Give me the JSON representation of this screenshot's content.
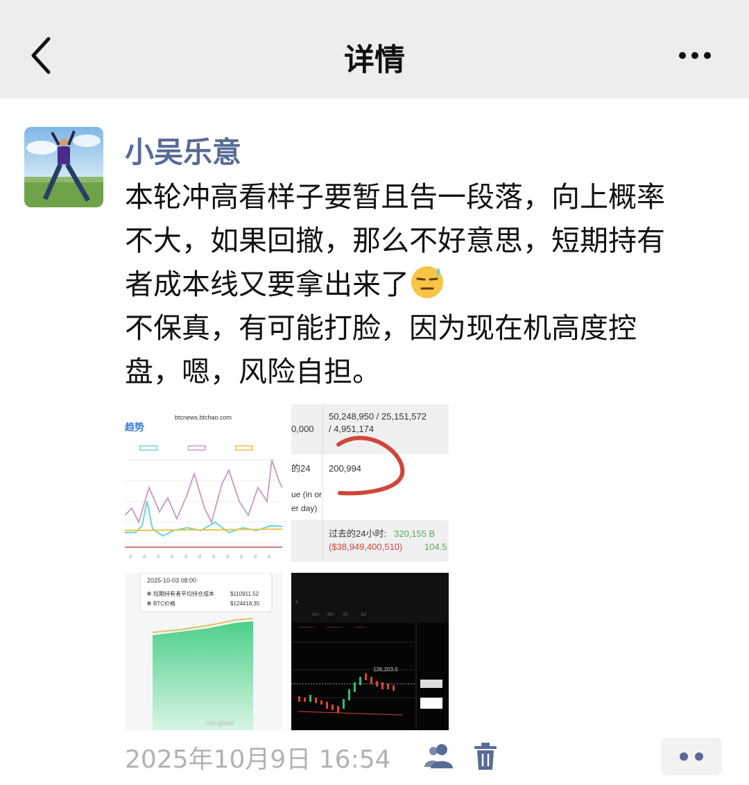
{
  "header": {
    "title": "详情",
    "back_icon": "chevron-left-icon",
    "more_icon": "ellipsis-icon"
  },
  "post": {
    "author": "小吴乐意",
    "text_lines": [
      "本轮冲高看样子要暂且告一段落，向上概率",
      "不大，如果回撤，那么不好意思，短期持有",
      "者成本线又要拿出来了",
      "不保真，有可能打脸，因为现在机高度控",
      "盘，嗯，风险自担。"
    ],
    "emoji": "sweat-face-emoji",
    "images": [
      {
        "kind": "line-chart-screenshot",
        "site": "btcnews.btchao.com",
        "heading": "趋势"
      },
      {
        "kind": "stats-screenshot",
        "line1": "50,248,950 / 25,151,572",
        "line1_left": "0,000",
        "line2": "/ 4,951,174",
        "label_a": "的24",
        "value_a": "200,994",
        "label_b": "ue (in or",
        "label_c": "er day)",
        "past24_label": "过去的24小时:",
        "past24_value": "320,155 B",
        "past24_usd": "($38,949,400,510)",
        "past24_tail": "104.5"
      },
      {
        "kind": "area-chart-screenshot",
        "date": "2025-10-03 08:00",
        "row1_label": "短期持有者平均持仓成本",
        "row1_value": "$110911.52",
        "row2_label": "BTC价格",
        "row2_value": "$124418.35",
        "watermark": "coinglass"
      },
      {
        "kind": "candlestick-screenshot",
        "price_label": "126,203.0"
      }
    ],
    "timestamp": "2025年10月9日 16:54",
    "actions": {
      "privacy_icon": "people-icon",
      "delete_icon": "trash-icon",
      "more_icon": "two-dots-icon"
    }
  },
  "colors": {
    "topbar_bg": "#ededed",
    "author": "#576b95",
    "timestamp": "#b2b2b2",
    "annotation_red": "#d0453a"
  }
}
